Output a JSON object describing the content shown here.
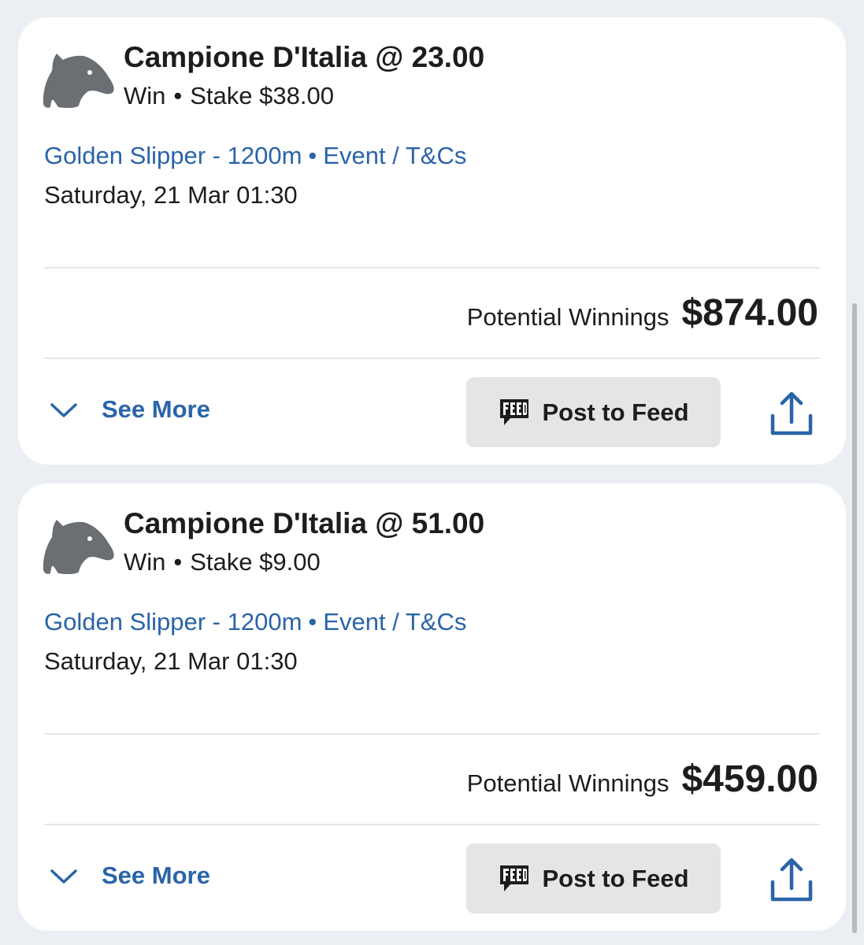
{
  "colors": {
    "background": "#ebeff3",
    "card": "#ffffff",
    "link": "#2a64a8",
    "text": "#1c1d1f",
    "icon_gray": "#6b6e72",
    "button_bg": "#e4e5e7"
  },
  "bets": [
    {
      "icon": "horse-head-icon",
      "title": "Campione D'Italia @ 23.00",
      "bet_type": "Win",
      "stake": "Stake $38.00",
      "event_name": "Golden Slipper - 1200m",
      "event_link": "Event / T&Cs",
      "date": "Saturday, 21 Mar 01:30",
      "winnings_label": "Potential Winnings",
      "winnings_value": "$874.00",
      "see_more_label": "See More",
      "feed_button_label": "Post to Feed",
      "share_icon": "share-icon"
    },
    {
      "icon": "horse-head-icon",
      "title": "Campione D'Italia @ 51.00",
      "bet_type": "Win",
      "stake": "Stake $9.00",
      "event_name": "Golden Slipper - 1200m",
      "event_link": "Event / T&Cs",
      "date": "Saturday, 21 Mar 01:30",
      "winnings_label": "Potential Winnings",
      "winnings_value": "$459.00",
      "see_more_label": "See More",
      "feed_button_label": "Post to Feed",
      "share_icon": "share-icon"
    }
  ]
}
